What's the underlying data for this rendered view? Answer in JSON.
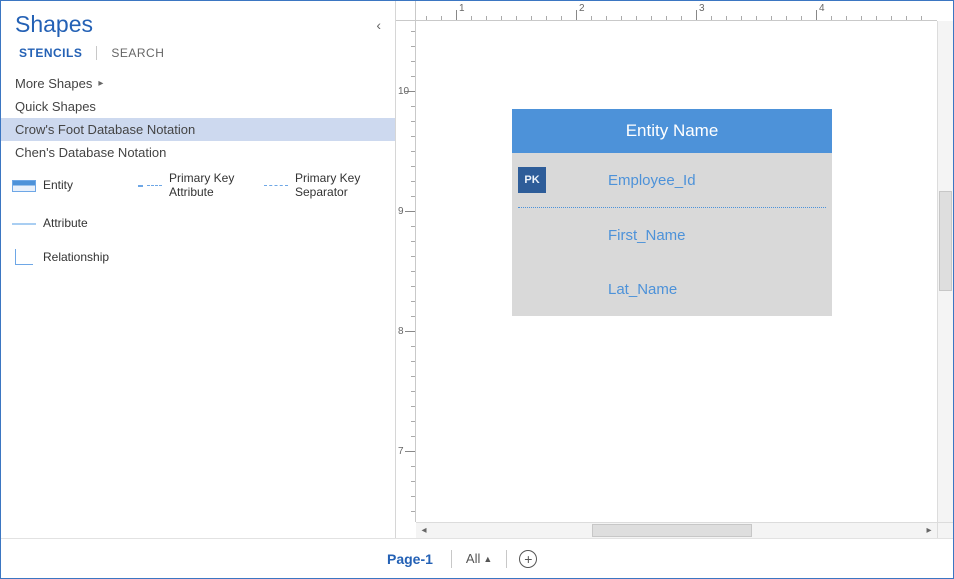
{
  "shapes_panel": {
    "title": "Shapes",
    "tabs": {
      "stencils": "STENCILS",
      "search": "SEARCH"
    },
    "nav": {
      "more_shapes": "More Shapes",
      "quick_shapes": "Quick Shapes",
      "crows_foot": "Crow's Foot Database Notation",
      "chen": "Chen's Database Notation"
    },
    "stencils": {
      "entity": "Entity",
      "pk_attribute": "Primary Key Attribute",
      "pk_separator": "Primary Key Separator",
      "attribute": "Attribute",
      "relationship": "Relationship"
    }
  },
  "canvas": {
    "h_labels": [
      "1",
      "2",
      "3",
      "4"
    ],
    "v_labels": [
      "10",
      "9",
      "8",
      "7"
    ],
    "entity": {
      "title": "Entity Name",
      "pk_badge": "PK",
      "rows": [
        "Employee_Id",
        "First_Name",
        "Lat_Name"
      ]
    }
  },
  "page_bar": {
    "page_tab": "Page-1",
    "all": "All"
  }
}
